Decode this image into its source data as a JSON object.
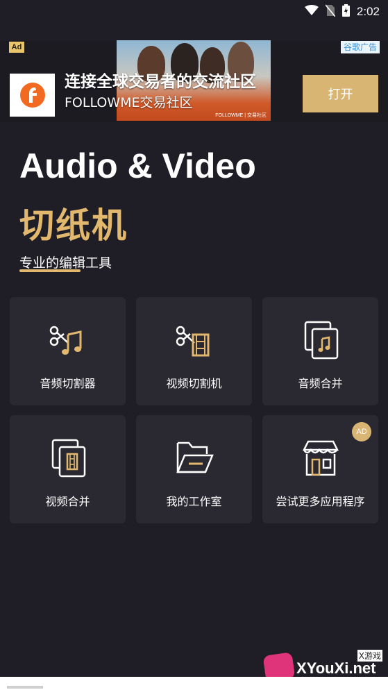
{
  "status_bar": {
    "time": "2:02"
  },
  "ad_banner": {
    "ad_label": "Ad",
    "network_label": "谷歌广告",
    "title": "连接全球交易者的交流社区",
    "subtitle": "FOLLOWME交易社区",
    "photo_caption": "FOLLOWME | 交易社区",
    "open_button": "打开"
  },
  "hero": {
    "title": "Audio & Video",
    "title_cn": "切纸机",
    "tagline": "专业的编辑工具"
  },
  "tiles": [
    {
      "label": "音频切割器",
      "icon": "audio-cutter-icon"
    },
    {
      "label": "视频切割机",
      "icon": "video-cutter-icon"
    },
    {
      "label": "音频合并",
      "icon": "audio-merge-icon"
    },
    {
      "label": "视频合并",
      "icon": "video-merge-icon"
    },
    {
      "label": "我的工作室",
      "icon": "folder-icon"
    },
    {
      "label": "尝试更多应用程序",
      "icon": "store-icon",
      "badge": "AD"
    }
  ],
  "watermark": {
    "text": "XYouXi.net",
    "small": "X游戏"
  },
  "colors": {
    "background": "#1f1e26",
    "tile": "#2a2932",
    "accent": "#e1b86e",
    "button": "#d9b574"
  }
}
